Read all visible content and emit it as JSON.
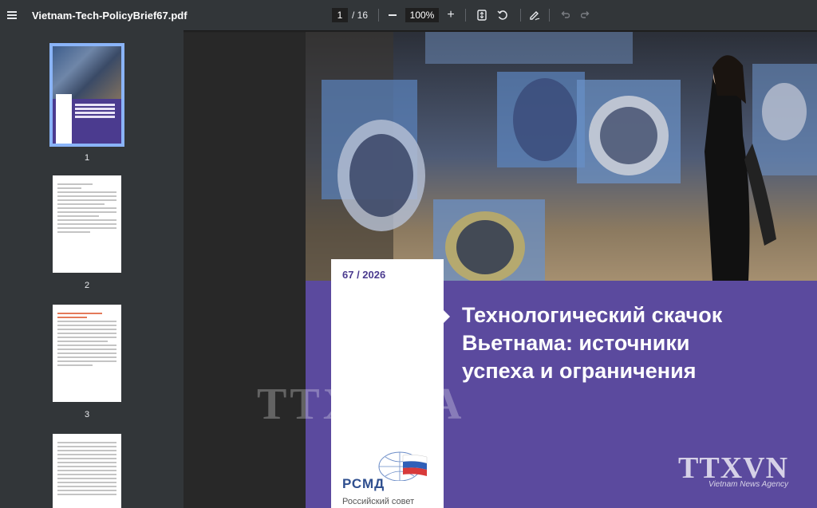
{
  "toolbar": {
    "file_title": "Vietnam-Tech-PolicyBrief67.pdf",
    "current_page": "1",
    "total_pages": "/ 16",
    "zoom": "100%",
    "zoom_minus_icon": "minus-icon",
    "zoom_plus_icon": "plus-icon",
    "fit_icon": "fit-page-icon",
    "rotate_icon": "rotate-icon",
    "annotate_icon": "annotate-icon",
    "undo_icon": "undo-icon",
    "redo_icon": "redo-icon"
  },
  "sidebar": {
    "thumbnails": [
      {
        "number": "1"
      },
      {
        "number": "2"
      },
      {
        "number": "3"
      }
    ]
  },
  "document": {
    "issue": "67 / 2026",
    "title": "Технологический скачок\nВьетнама: источники\nуспеха и ограничения",
    "logo_text": "РСМД",
    "logo_subtitle": "Российский совет"
  },
  "watermark": {
    "center": "TTXVNA",
    "corner": "TTXVN",
    "corner_sub": "Vietnam News Agency"
  },
  "colors": {
    "toolbar": "#323639",
    "background": "#282828",
    "accent_purple": "#5b4a9e",
    "selection": "#8ab4f8"
  }
}
